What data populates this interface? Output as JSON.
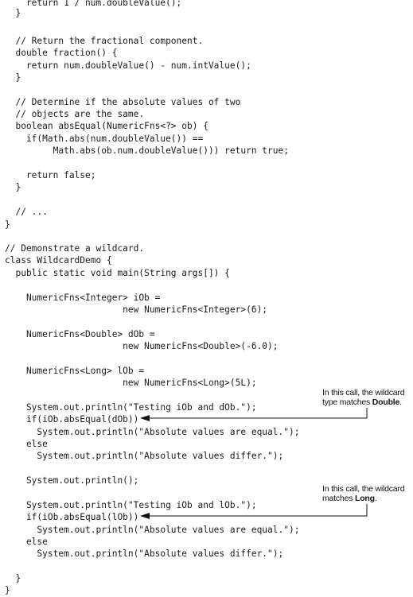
{
  "code_lines": [
    "    return 1 / num.doubleValue();",
    "  }",
    "",
    "  // Return the fractional component.",
    "  double fraction() {",
    "    return num.doubleValue() - num.intValue();",
    "  }",
    "",
    "  // Determine if the absolute values of two",
    "  // objects are the same.",
    "  boolean absEqual(NumericFns<?> ob) {",
    "    if(Math.abs(num.doubleValue()) ==",
    "         Math.abs(ob.num.doubleValue())) return true;",
    "",
    "    return false;",
    "  }",
    "",
    "  // ...",
    "}",
    "",
    "// Demonstrate a wildcard.",
    "class WildcardDemo {",
    "  public static void main(String args[]) {",
    "",
    "    NumericFns<Integer> iOb =",
    "                      new NumericFns<Integer>(6);",
    "",
    "    NumericFns<Double> dOb =",
    "                      new NumericFns<Double>(-6.0);",
    "",
    "    NumericFns<Long> lOb =",
    "                      new NumericFns<Long>(5L);",
    "",
    "    System.out.println(\"Testing iOb and dOb.\");",
    "    if(iOb.absEqual(dOb))",
    "      System.out.println(\"Absolute values are equal.\");",
    "    else",
    "      System.out.println(\"Absolute values differ.\");",
    "",
    "    System.out.println();",
    "",
    "    System.out.println(\"Testing iOb and lOb.\");",
    "    if(iOb.absEqual(lOb))",
    "      System.out.println(\"Absolute values are equal.\");",
    "    else",
    "      System.out.println(\"Absolute values differ.\");",
    "",
    "  }",
    "}"
  ],
  "callouts": [
    {
      "line1": "In this call, the wildcard",
      "line2_prefix": "type matches ",
      "line2_emphasis": "Double",
      "line2_suffix": "."
    },
    {
      "line1": "In this call, the wildcard",
      "line2_prefix": "matches ",
      "line2_emphasis": "Long",
      "line2_suffix": "."
    }
  ]
}
